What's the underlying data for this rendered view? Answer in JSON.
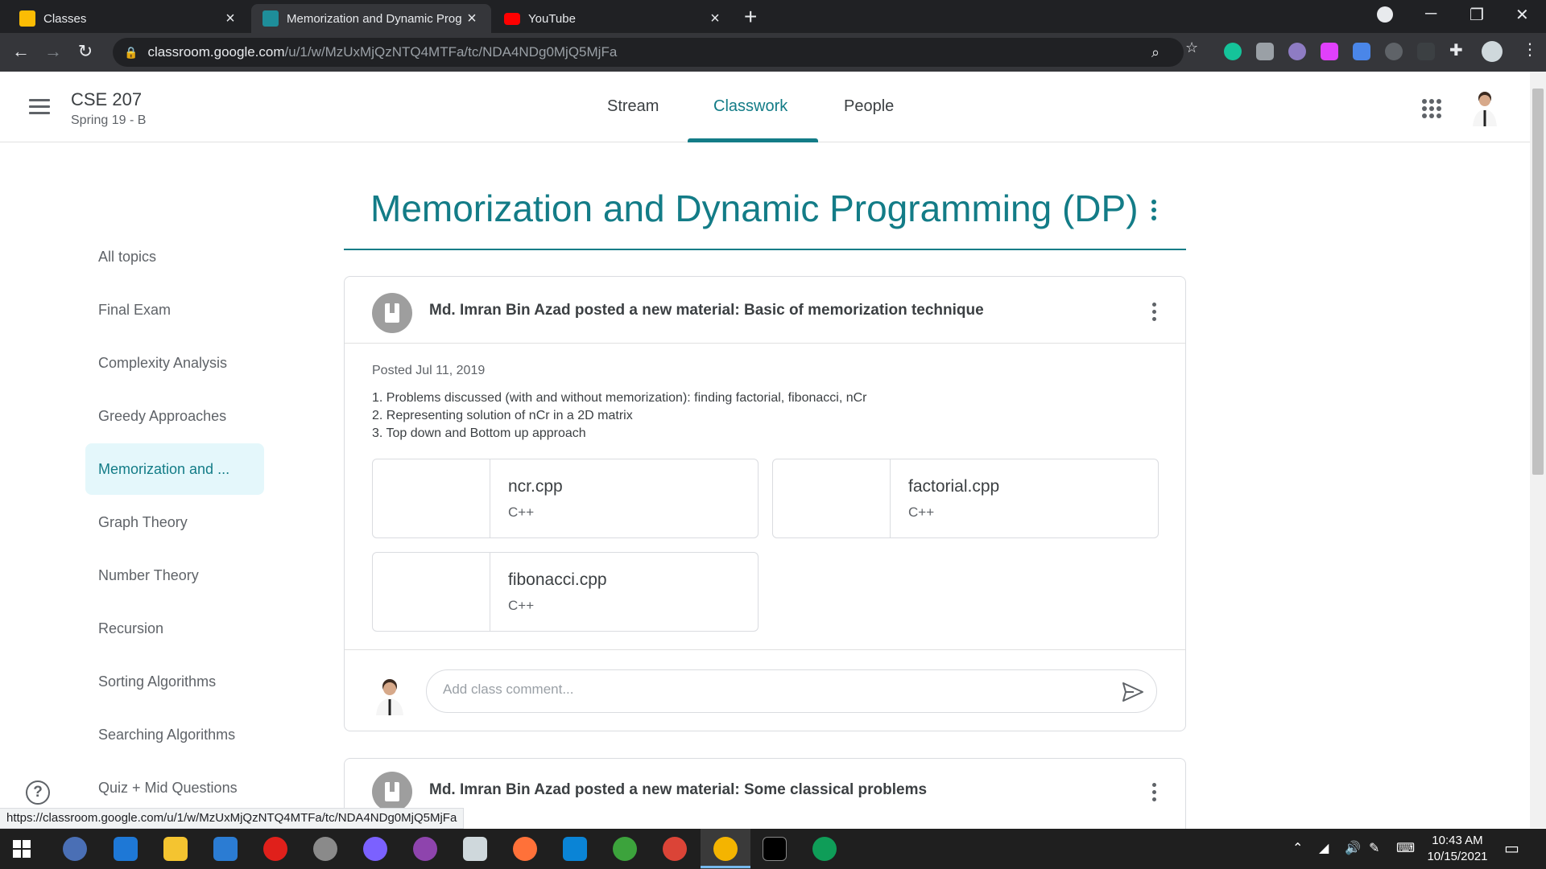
{
  "browser": {
    "tabs": [
      {
        "title": "Classes",
        "active": false
      },
      {
        "title": "Memorization and Dynamic Prog",
        "active": true
      },
      {
        "title": "YouTube",
        "active": false
      }
    ],
    "url_host": "classroom.google.com",
    "url_path": "/u/1/w/MzUxMjQzNTQ4MTFa/tc/NDA4NDg0MjQ5MjFa"
  },
  "header": {
    "class_name": "CSE 207",
    "section": "Spring 19 - B",
    "nav": [
      "Stream",
      "Classwork",
      "People"
    ],
    "active_nav": "Classwork"
  },
  "sidebar": {
    "topics": [
      "All topics",
      "Final Exam",
      "Complexity Analysis",
      "Greedy Approaches",
      "Memorization and ...",
      "Graph Theory",
      "Number Theory",
      "Recursion",
      "Sorting Algorithms",
      "Searching Algorithms",
      "Quiz + Mid Questions"
    ],
    "active_topic": "Memorization and ..."
  },
  "main": {
    "topic_title": "Memorization and Dynamic Programming (DP)",
    "posts": [
      {
        "header": "Md. Imran Bin Azad posted a new material: Basic of memorization technique",
        "posted": "Posted Jul 11, 2019",
        "description": [
          "1. Problems discussed (with and without memorization): finding factorial, fibonacci, nCr",
          "2. Representing solution of nCr in a 2D matrix",
          "3. Top down and Bottom up approach"
        ],
        "attachments": [
          {
            "name": "ncr.cpp",
            "type": "C++"
          },
          {
            "name": "factorial.cpp",
            "type": "C++"
          },
          {
            "name": "fibonacci.cpp",
            "type": "C++"
          }
        ],
        "comment_placeholder": "Add class comment..."
      },
      {
        "header": "Md. Imran Bin Azad posted a new material: Some classical problems"
      }
    ]
  },
  "status_bar_url": "https://classroom.google.com/u/1/w/MzUxMjQzNTQ4MTFa/tc/NDA4NDg0MjQ5MjFa",
  "taskbar": {
    "time": "10:43 AM",
    "date": "10/15/2021"
  },
  "colors": {
    "accent": "#137c87",
    "active_topic_bg": "#e4f7fb"
  }
}
